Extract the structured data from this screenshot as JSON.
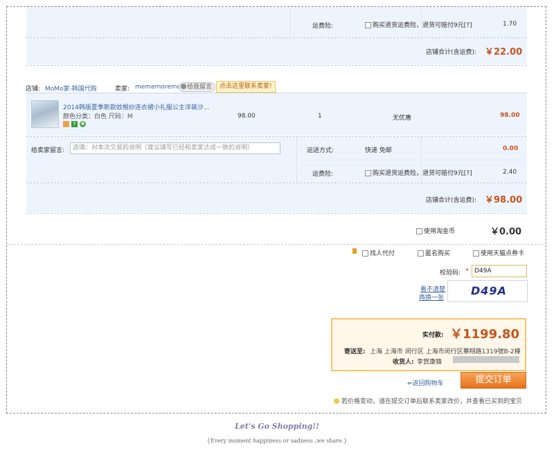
{
  "store1": {
    "shipping_ins_label": "运费险:",
    "shipping_ins_option": "购买退货运费险，退货可赔付9元[?]",
    "shipping_ins_price": "1.70",
    "total_label": "店铺合计(含运费):",
    "total_value": "￥22.00"
  },
  "store2": {
    "shop_label": "店铺:",
    "shop_name": "MoMo家-韩国代购",
    "seller_label": "卖家:",
    "seller_name": "mememoremo",
    "message_btn": "给我留言",
    "contact_btn": "点击这里联系卖家!",
    "item": {
      "title": "2014韩版夏季新款蚊根纱连衣裙小礼服公主洋装沙...",
      "attrs": "颜色分类：白色   尺码：M",
      "price": "98.00",
      "qty": "1",
      "discount": "无优惠",
      "subtotal": "98.00",
      "tags": [
        "7"
      ]
    },
    "msg_label": "给卖家留言:",
    "msg_placeholder": "选填：对本次交易的说明（建议填写已经和卖家达成一致的说明）",
    "delivery_label": "运送方式:",
    "delivery_value": "快递 免邮",
    "delivery_price": "0.00",
    "shipping_ins_label": "运费险:",
    "shipping_ins_option": "购买退货运费险，退货可赔付9元[?]",
    "shipping_ins_price": "2.40",
    "total_label": "店铺合计(含运费):",
    "total_value": "￥98.00"
  },
  "coins": {
    "label": "使用淘金币",
    "value": "￥0.00"
  },
  "options": {
    "friend_pay": "找人代付",
    "anonymous": "匿名购买",
    "tmall_card": "使用天猫点券卡"
  },
  "captcha": {
    "label": "校验码:",
    "required": "•",
    "value": "D49A",
    "refresh_line1": "看不清楚",
    "refresh_line2": "再换一张",
    "image_text": "D49A"
  },
  "payment": {
    "label": "实付款:",
    "value": "￥1199.80",
    "address_label": "寄送至:",
    "address": "上海 上海市 闵行区 上海市闵行区華翔路1319號B-2棟",
    "receiver_label": "收货人:",
    "receiver": "李賀康鋒"
  },
  "actions": {
    "back_to_cart": "返回购物车",
    "submit": "提交订单"
  },
  "notice": "若价格变动，请在提交订单后联系卖家改价，并查看已买到的宝贝",
  "footer": {
    "title": "Let's Go Shopping!!",
    "subtitle": "{Every moment happiness or sadness ,we share.}"
  },
  "colors": {
    "band": "#eef4fd",
    "price_orange": "#c7531d",
    "submit_orange": "#e7731c",
    "link_blue": "#3a63a3"
  }
}
